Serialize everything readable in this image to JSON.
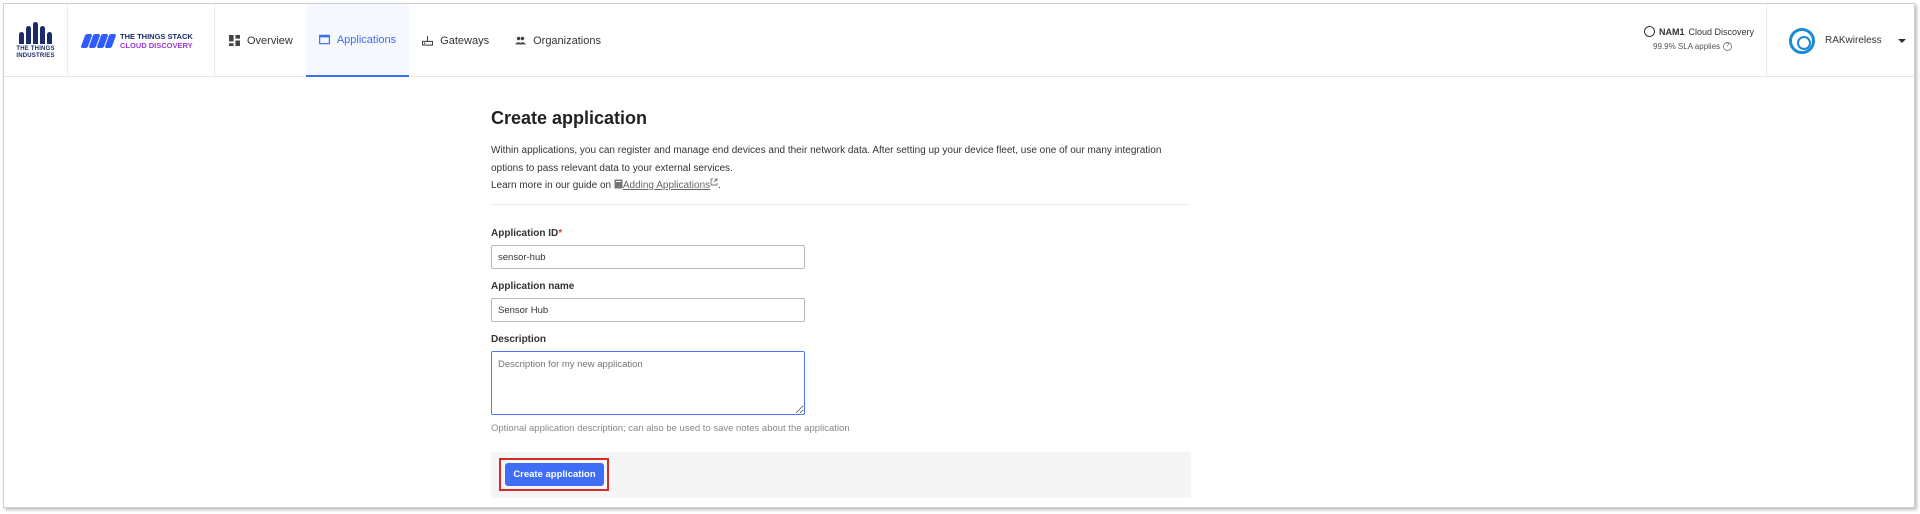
{
  "brand": {
    "company_line1": "THE THINGS",
    "company_line2": "INDUSTRIES",
    "product_line1": "THE THINGS STACK",
    "product_line2": "CLOUD DISCOVERY"
  },
  "nav": {
    "items": [
      {
        "label": "Overview",
        "icon": "dashboard-icon"
      },
      {
        "label": "Applications",
        "icon": "application-icon",
        "active": true
      },
      {
        "label": "Gateways",
        "icon": "router-icon"
      },
      {
        "label": "Organizations",
        "icon": "people-icon"
      }
    ]
  },
  "cluster": {
    "region": "NAM1",
    "name": "Cloud Discovery",
    "sla": "99.9% SLA applies"
  },
  "user": {
    "name": "RAKwireless"
  },
  "page": {
    "title": "Create application",
    "intro": "Within applications, you can register and manage end devices and their network data. After setting up your device fleet, use one of our many integration options to pass relevant data to your external services.",
    "guide_prefix": "Learn more in our guide on",
    "guide_link": "Adding Applications",
    "guide_suffix": "."
  },
  "form": {
    "app_id_label": "Application ID",
    "app_id_required_mark": "*",
    "app_id_value": "sensor-hub",
    "app_name_label": "Application name",
    "app_name_value": "Sensor Hub",
    "description_label": "Description",
    "description_placeholder": "Description for my new application",
    "description_hint": "Optional application description; can also be used to save notes about the application",
    "submit_label": "Create application"
  },
  "colors": {
    "accent": "#3f6df5",
    "highlight": "#d32a2a",
    "brand_purple": "#9c3bd6"
  }
}
